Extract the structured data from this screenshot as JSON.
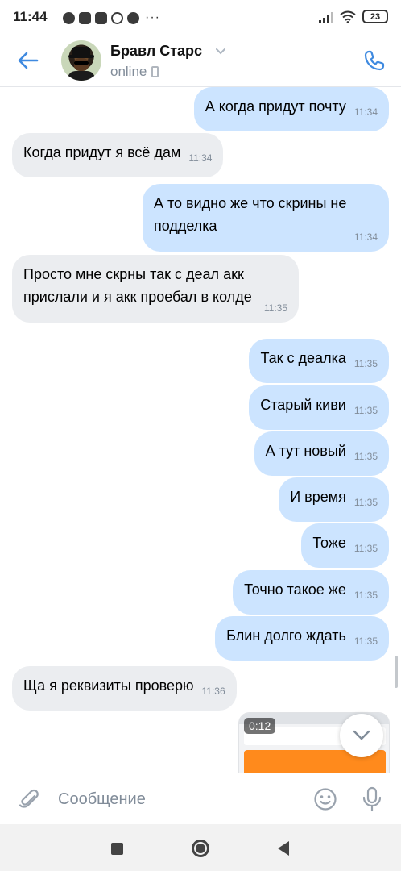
{
  "status_bar": {
    "time": "11:44",
    "battery": "23"
  },
  "header": {
    "contact_name": "Бравл Старс",
    "status": "online"
  },
  "messages": [
    {
      "dir": "out",
      "text": "А когда придут почту",
      "time": "11:34"
    },
    {
      "dir": "in",
      "text": "Когда придут я всё дам",
      "time": "11:34"
    },
    {
      "dir": "out",
      "text": "А то видно же что скрины не подделка",
      "time": "11:34"
    },
    {
      "dir": "in",
      "text": "Просто мне скрны так с деал акк прислали и я акк проебал в колде",
      "time": "11:35"
    },
    {
      "dir": "out",
      "text": "Так с деалка",
      "time": "11:35"
    },
    {
      "dir": "out",
      "text": "Старый киви",
      "time": "11:35"
    },
    {
      "dir": "out",
      "text": "А тут новый",
      "time": "11:35"
    },
    {
      "dir": "out",
      "text": "И время",
      "time": "11:35"
    },
    {
      "dir": "out",
      "text": "Тоже",
      "time": "11:35"
    },
    {
      "dir": "out",
      "text": "Точно такое же",
      "time": "11:35"
    },
    {
      "dir": "out",
      "text": "Блин долго ждать",
      "time": "11:35"
    },
    {
      "dir": "in",
      "text": "Ща я реквизиты проверю",
      "time": "11:36"
    }
  ],
  "video_attachment": {
    "duration": "0:12"
  },
  "composer": {
    "placeholder": "Сообщение"
  },
  "colors": {
    "accent": "#3f8ae0",
    "outgoing_bubble": "#cce4ff",
    "incoming_bubble": "#ebedf0"
  }
}
